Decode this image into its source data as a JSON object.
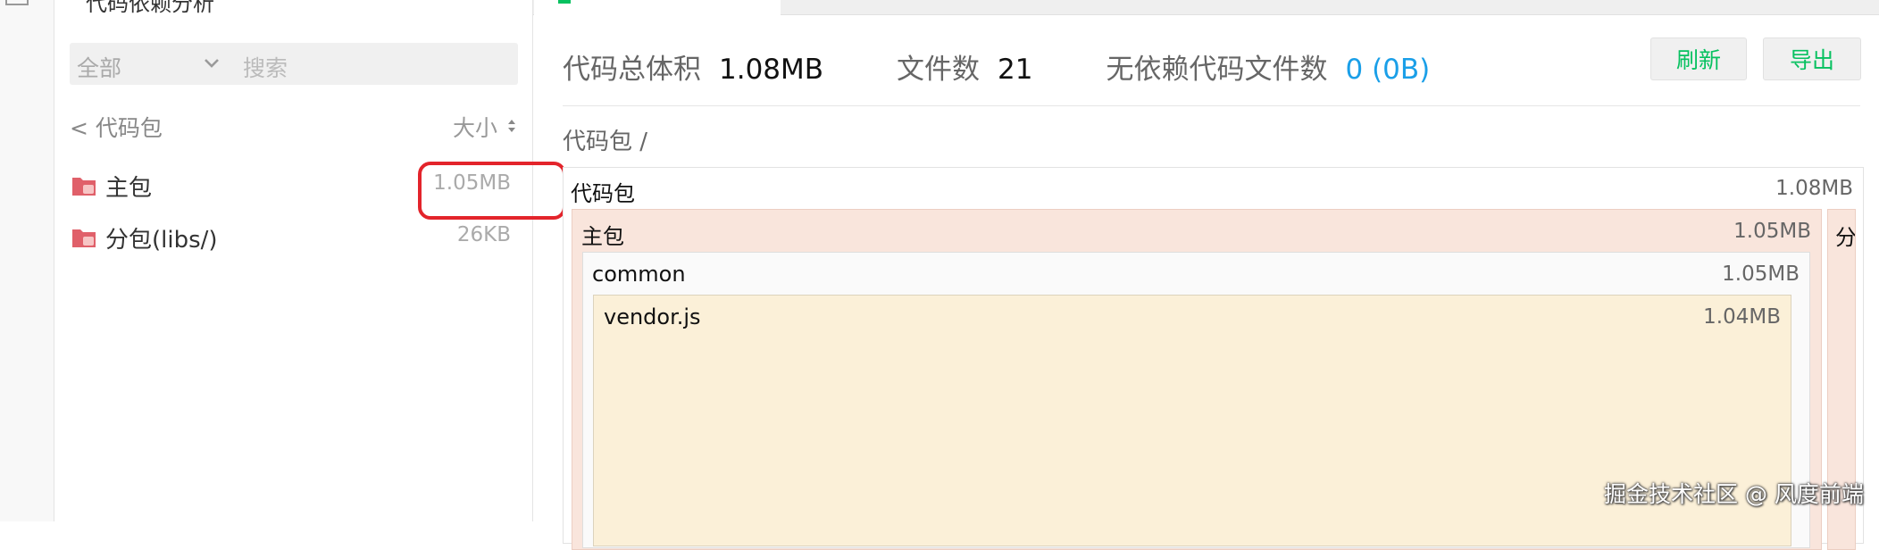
{
  "sidebar": {
    "title": "代码依赖分析",
    "filter": {
      "selected": "全部",
      "placeholder": "搜索"
    },
    "back_label": "< 代码包",
    "sort_label": "大小",
    "items": [
      {
        "name": "主包",
        "size": "1.05MB",
        "icon": "folder-icon"
      },
      {
        "name": "分包(libs/)",
        "size": "26KB",
        "icon": "folder-icon"
      }
    ]
  },
  "summary": {
    "total_label": "代码总体积",
    "total_value": "1.08MB",
    "files_label": "文件数",
    "files_value": "21",
    "nodep_label": "无依赖代码文件数",
    "nodep_value": "0 (0B)"
  },
  "actions": {
    "refresh": "刷新",
    "export": "导出"
  },
  "breadcrumb": "代码包 /",
  "treemap": {
    "root": {
      "name": "代码包",
      "size": "1.08MB"
    },
    "main": {
      "name": "主包",
      "size": "1.05MB"
    },
    "sub": {
      "name": "分"
    },
    "common": {
      "name": "common",
      "size": "1.05MB"
    },
    "vendor": {
      "name": "vendor.js",
      "size": "1.04MB"
    }
  },
  "watermark": "掘金技术社区 @ 风度前端",
  "colors": {
    "accent_green": "#07c160",
    "link_blue": "#1a9fe8",
    "highlight_red": "#e3242b",
    "folder_red": "#e0606a"
  }
}
